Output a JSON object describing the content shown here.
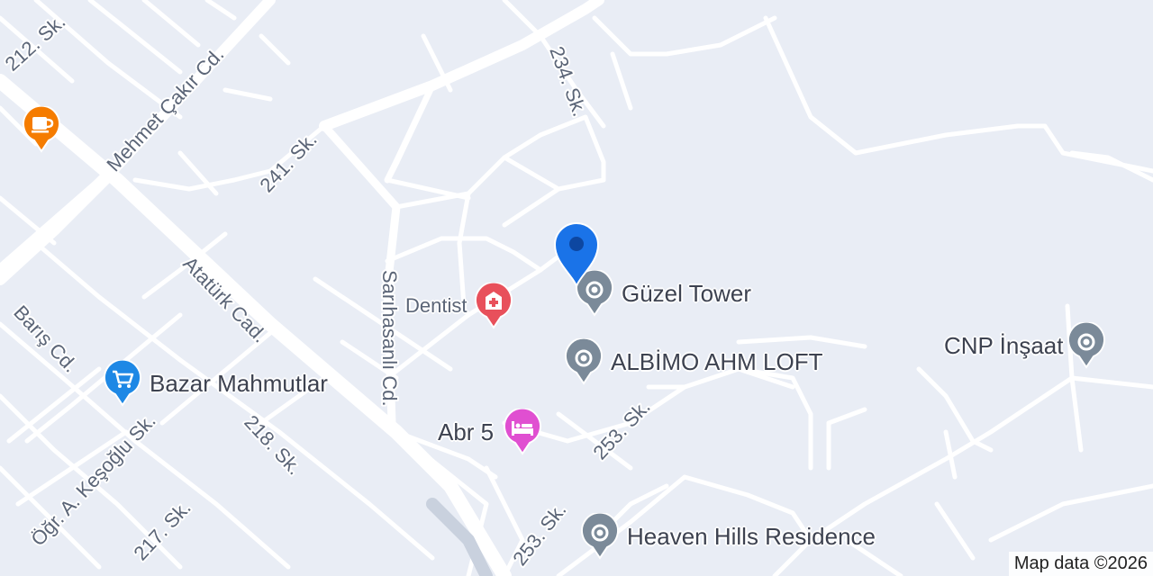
{
  "streets": {
    "s212": "212. Sk.",
    "mehmet_cakir": "Mehmet Çakır Cd.",
    "s241": "241. Sk.",
    "s234": "234. Sk.",
    "ataturk": "Atatürk Cad.",
    "sarihasanli": "Sarıhasanlı Cd.",
    "baris": "Barış Cd.",
    "ogr_kesoglu": "Öğr. A. Keşoğlu Sk.",
    "s218": "218. Sk.",
    "s217": "217. Sk.",
    "s253a": "253. Sk.",
    "s253b": "253. Sk."
  },
  "pois": {
    "guzel_tower": {
      "label": "Güzel Tower",
      "icon": "location-pin-icon",
      "color": "#7b8a99"
    },
    "albimo": {
      "label": "ALBİMO AHM LOFT",
      "icon": "location-pin-icon",
      "color": "#7b8a99"
    },
    "cnp": {
      "label": "CNP İnşaat",
      "icon": "location-pin-icon",
      "color": "#7b8a99"
    },
    "heaven_hills": {
      "label": "Heaven Hills Residence",
      "icon": "location-pin-icon",
      "color": "#7b8a99"
    },
    "dentist": {
      "label": "Dentist",
      "icon": "medical-icon",
      "color": "#e8505b"
    },
    "abr5": {
      "label": "Abr 5",
      "icon": "hotel-bed-icon",
      "color": "#e04fd1"
    },
    "bazar": {
      "label": "Bazar Mahmutlar",
      "icon": "shopping-cart-icon",
      "color": "#1e88e5"
    },
    "cafe": {
      "label": "",
      "icon": "coffee-cup-icon",
      "color": "#f57c00"
    }
  },
  "marker": {
    "icon": "current-location-marker-icon",
    "color": "#1a73e8"
  },
  "attribution": "Map data ©2026",
  "colors": {
    "background": "#e9edf5",
    "road": "#ffffff"
  }
}
